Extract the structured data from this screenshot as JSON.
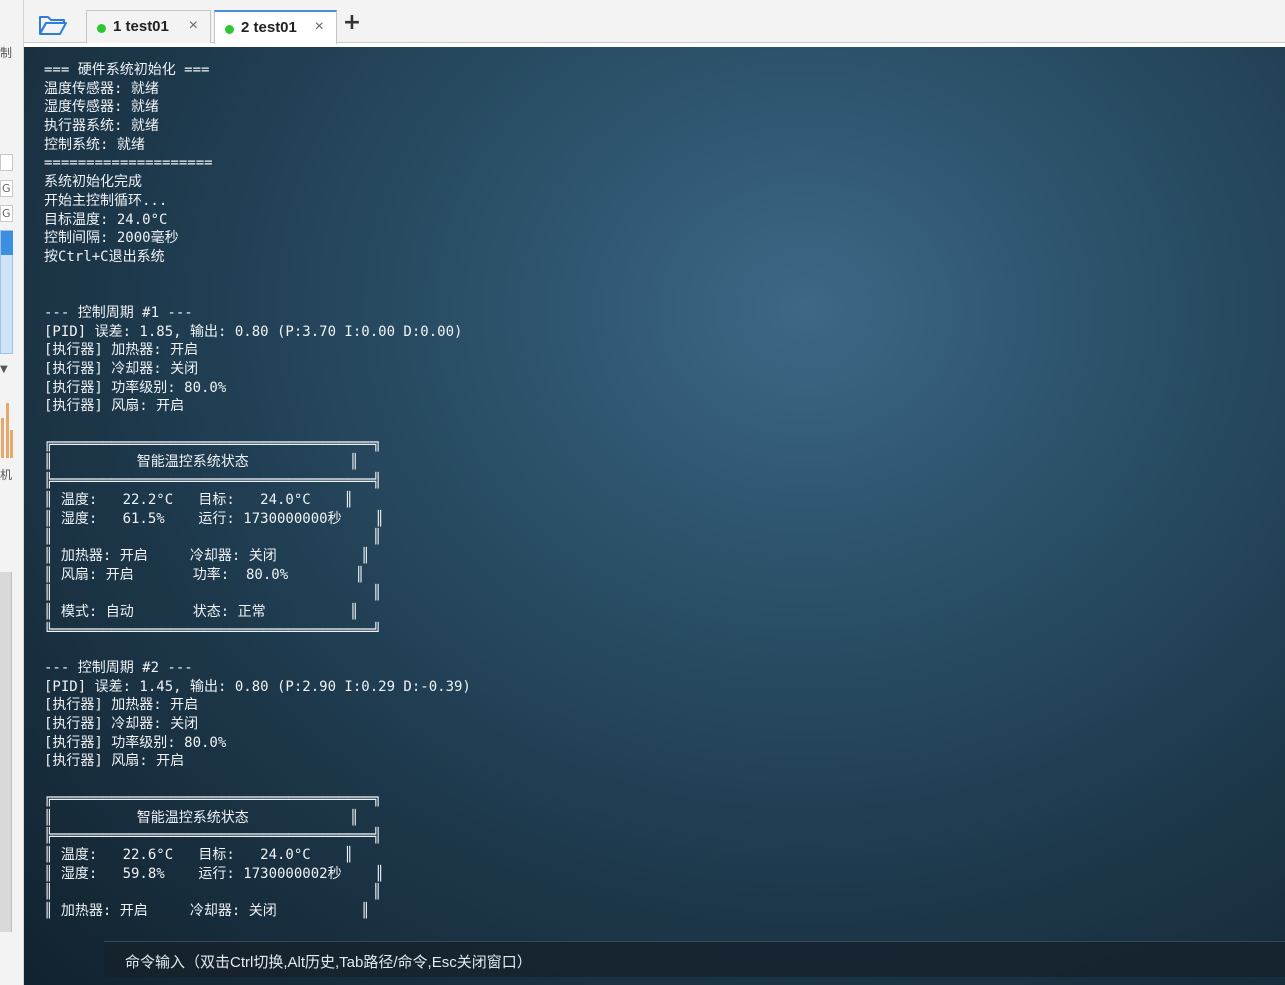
{
  "left_panel": {
    "text_top": "制",
    "box1": "G",
    "box2": "G",
    "text_mid": "机"
  },
  "tabs": [
    {
      "label": "1  test01",
      "close": "×",
      "status_color": "#2ec62e"
    },
    {
      "label": "2  test01",
      "close": "×",
      "status_color": "#2ec62e"
    }
  ],
  "add_tab_label": "+",
  "terminal": {
    "lines": [
      "=== 硬件系统初始化 ===",
      "温度传感器: 就绪",
      "湿度传感器: 就绪",
      "执行器系统: 就绪",
      "控制系统: 就绪",
      "====================",
      "系统初始化完成",
      "开始主控制循环...",
      "目标温度: 24.0°C",
      "控制间隔: 2000毫秒",
      "按Ctrl+C退出系统",
      "",
      "",
      "--- 控制周期 #1 ---",
      "[PID] 误差: 1.85, 输出: 0.80 (P:3.70 I:0.00 D:0.00)",
      "[执行器] 加热器: 开启",
      "[执行器] 冷却器: 关闭",
      "[执行器] 功率级别: 80.0%",
      "[执行器] 风扇: 开启",
      "",
      "╔══════════════════════════════════════╗",
      "║          智能温控系统状态            ║",
      "╠══════════════════════════════════════╣",
      "║ 温度:   22.2°C   目标:   24.0°C    ║",
      "║ 湿度:   61.5%    运行: 1730000000秒    ║",
      "║                                      ║",
      "║ 加热器: 开启     冷却器: 关闭          ║",
      "║ 风扇: 开启       功率:  80.0%        ║",
      "║                                      ║",
      "║ 模式: 自动       状态: 正常          ║",
      "╚══════════════════════════════════════╝",
      "",
      "--- 控制周期 #2 ---",
      "[PID] 误差: 1.45, 输出: 0.80 (P:2.90 I:0.29 D:-0.39)",
      "[执行器] 加热器: 开启",
      "[执行器] 冷却器: 关闭",
      "[执行器] 功率级别: 80.0%",
      "[执行器] 风扇: 开启",
      "",
      "╔══════════════════════════════════════╗",
      "║          智能温控系统状态            ║",
      "╠══════════════════════════════════════╣",
      "║ 温度:   22.6°C   目标:   24.0°C    ║",
      "║ 湿度:   59.8%    运行: 1730000002秒    ║",
      "║                                      ║",
      "║ 加热器: 开启     冷却器: 关闭          ║"
    ]
  },
  "command_bar": {
    "label": "命令输入（双击Ctrl切换,Alt历史,Tab路径/命令,Esc关闭窗口）"
  },
  "colors": {
    "terminal_bg": "#1d384b",
    "terminal_text": "#eef2f5",
    "tab_accent": "#4a8fdd",
    "status_green": "#2ec62e"
  }
}
